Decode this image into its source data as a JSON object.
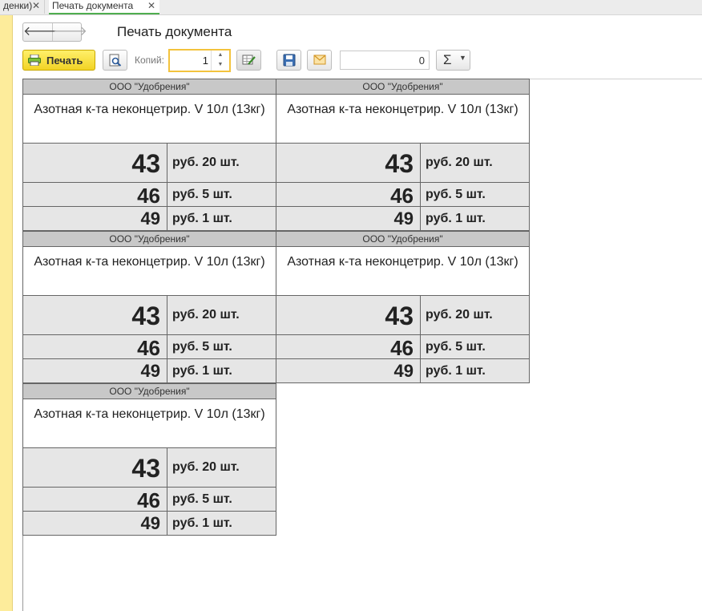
{
  "tabs": [
    {
      "label": "денки)"
    },
    {
      "label": "Печать документа"
    }
  ],
  "header": {
    "title": "Печать документа"
  },
  "toolbar": {
    "print_label": "Печать",
    "copies_label": "Копий:",
    "copies_value": "1",
    "sum_value": "0",
    "sigma_label": "Σ"
  },
  "labels": [
    {
      "org": "ООО \"Удобрения\"",
      "product": "Азотная к-та неконцетрир. V 10л (13кг)",
      "rows": [
        {
          "price": "43",
          "unit": "руб. 20 шт."
        },
        {
          "price": "46",
          "unit": "руб. 5 шт."
        },
        {
          "price": "49",
          "unit": "руб. 1 шт."
        }
      ]
    },
    {
      "org": "ООО \"Удобрения\"",
      "product": "Азотная к-та неконцетрир. V 10л (13кг)",
      "rows": [
        {
          "price": "43",
          "unit": "руб. 20 шт."
        },
        {
          "price": "46",
          "unit": "руб. 5 шт."
        },
        {
          "price": "49",
          "unit": "руб. 1 шт."
        }
      ]
    },
    {
      "org": "ООО \"Удобрения\"",
      "product": "Азотная к-та неконцетрир. V 10л (13кг)",
      "rows": [
        {
          "price": "43",
          "unit": "руб. 20 шт."
        },
        {
          "price": "46",
          "unit": "руб. 5 шт."
        },
        {
          "price": "49",
          "unit": "руб. 1 шт."
        }
      ]
    },
    {
      "org": "ООО \"Удобрения\"",
      "product": "Азотная к-та неконцетрир. V 10л (13кг)",
      "rows": [
        {
          "price": "43",
          "unit": "руб. 20 шт."
        },
        {
          "price": "46",
          "unit": "руб. 5 шт."
        },
        {
          "price": "49",
          "unit": "руб. 1 шт."
        }
      ]
    },
    {
      "org": "ООО \"Удобрения\"",
      "product": "Азотная к-та неконцетрир. V 10л (13кг)",
      "rows": [
        {
          "price": "43",
          "unit": "руб. 20 шт."
        },
        {
          "price": "46",
          "unit": "руб. 5 шт."
        },
        {
          "price": "49",
          "unit": "руб. 1 шт."
        }
      ]
    }
  ],
  "icons": {
    "close": "close-icon",
    "back": "arrow-left-icon",
    "forward": "arrow-right-icon",
    "print": "printer-icon",
    "preview": "preview-icon",
    "edit": "edit-table-icon",
    "save": "save-icon",
    "mail": "envelope-icon",
    "dropdown": "chevron-down-icon"
  },
  "colors": {
    "print_button": "#f2d325",
    "active_tab": "#4fae4f",
    "copies_focus": "#f3c33d",
    "side_strip": "#fdec9b"
  }
}
